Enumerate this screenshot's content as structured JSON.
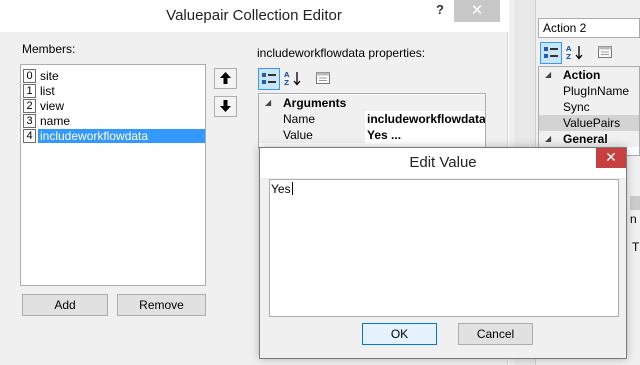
{
  "editor": {
    "title": "Valuepair Collection Editor",
    "help_label": "?",
    "close_label": "✕",
    "members_label": "Members:",
    "members": [
      {
        "index": "0",
        "name": "site"
      },
      {
        "index": "1",
        "name": "list"
      },
      {
        "index": "2",
        "name": "view"
      },
      {
        "index": "3",
        "name": "name"
      },
      {
        "index": "4",
        "name": "includeworkflowdata"
      }
    ],
    "selected_member": 4,
    "move_up_label": "🡅",
    "move_down_label": "🡇",
    "add_label": "Add",
    "remove_label": "Remove",
    "properties_label": "includeworkflowdata properties:",
    "properties": {
      "category": "Arguments",
      "rows": [
        {
          "key": "Name",
          "value": "includeworkflowdata"
        },
        {
          "key": "Value",
          "value": "Yes ..."
        }
      ]
    }
  },
  "right_panel": {
    "object_name": "Action 2",
    "categories": [
      {
        "name": "Action",
        "rows": [
          "PlugInName",
          "Sync",
          "ValuePairs"
        ]
      },
      {
        "name": "General",
        "rows": []
      }
    ],
    "selected_row": "ValuePairs",
    "fragment_1": "n",
    "fragment_2": "T"
  },
  "edit_dialog": {
    "title": "Edit Value",
    "close_label": "✕",
    "text": "Yes",
    "ok_label": "OK",
    "cancel_label": "Cancel"
  },
  "colors": {
    "selection": "#3399ff",
    "dialog_close": "#c74040",
    "window_bg": "#f0f0f0"
  }
}
